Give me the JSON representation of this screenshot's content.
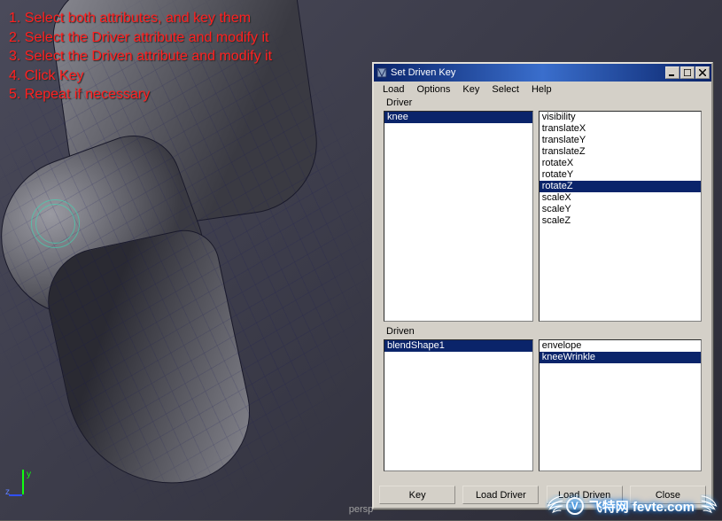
{
  "instructions": [
    "1. Select both attributes, and key them",
    "2. Select the Driver attribute and modify it",
    "3. Select the Driven attribute and modify it",
    "4. Click Key",
    "5. Repeat if necessary"
  ],
  "dialog": {
    "title": "Set Driven Key",
    "menu": [
      "Load",
      "Options",
      "Key",
      "Select",
      "Help"
    ],
    "driver": {
      "label": "Driver",
      "left_items": [
        "knee"
      ],
      "left_selected": "knee",
      "right_items": [
        "visibility",
        "translateX",
        "translateY",
        "translateZ",
        "rotateX",
        "rotateY",
        "rotateZ",
        "scaleX",
        "scaleY",
        "scaleZ"
      ],
      "right_selected": "rotateZ"
    },
    "driven": {
      "label": "Driven",
      "left_items": [
        "blendShape1"
      ],
      "left_selected": "blendShape1",
      "right_items": [
        "envelope",
        "kneeWrinkle"
      ],
      "right_selected": "kneeWrinkle"
    },
    "buttons": {
      "key": "Key",
      "load_driver": "Load Driver",
      "load_driven": "Load Driven",
      "close": "Close"
    }
  },
  "viewport": {
    "label": "persp",
    "axis": {
      "y": "y",
      "z": "z"
    }
  },
  "watermark": "飞特网 fevte.com"
}
